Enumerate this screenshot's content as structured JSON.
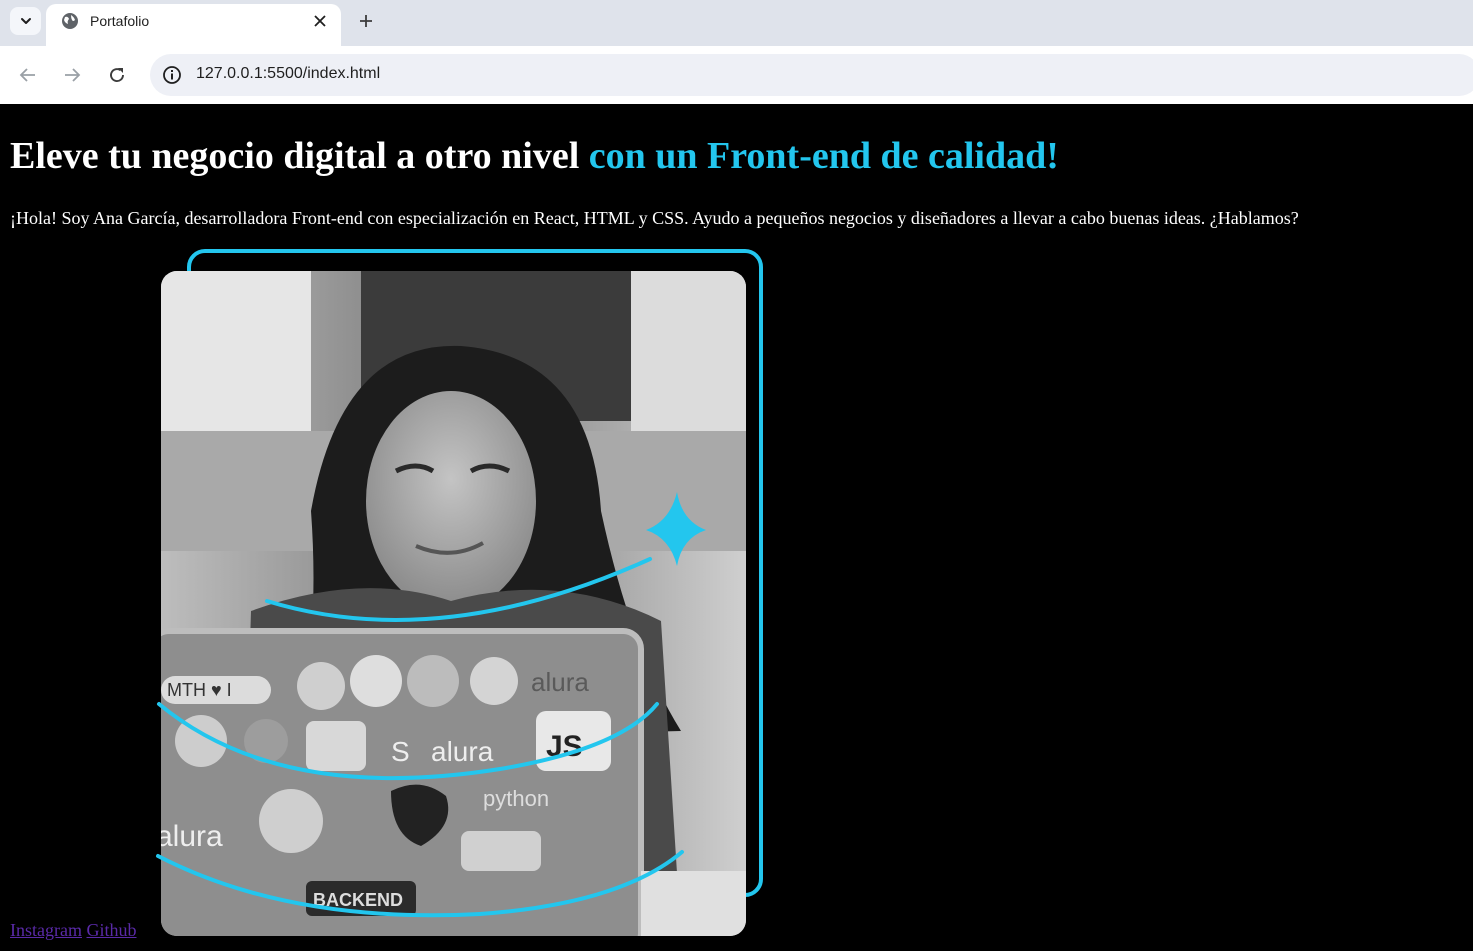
{
  "browser": {
    "tab_title": "Portafolio",
    "url": "127.0.0.1:5500/index.html"
  },
  "page": {
    "heading_main": "Eleve tu negocio digital a otro nivel",
    "heading_accent": "con un Front-end de calidad!",
    "intro": "¡Hola! Soy Ana García, desarrolladora Front-end con especialización en React, HTML y CSS. Ayudo a pequeños negocios y diseñadores a llevar a cabo buenas ideas. ¿Hablamos?",
    "links": [
      {
        "label": "Instagram"
      },
      {
        "label": "Github"
      }
    ],
    "stickers": [
      "MTH ♥ I",
      "alura",
      "JS",
      "S",
      "alura",
      "python",
      "alura",
      "BACKEND"
    ]
  },
  "colors": {
    "accent": "#23c6ee",
    "background": "#000000",
    "link_visited": "#5a2aa8"
  },
  "icons": [
    "chevron-down-icon",
    "globe-icon",
    "close-icon",
    "plus-icon",
    "back-arrow-icon",
    "forward-arrow-icon",
    "reload-icon",
    "info-icon",
    "sparkle-icon"
  ]
}
